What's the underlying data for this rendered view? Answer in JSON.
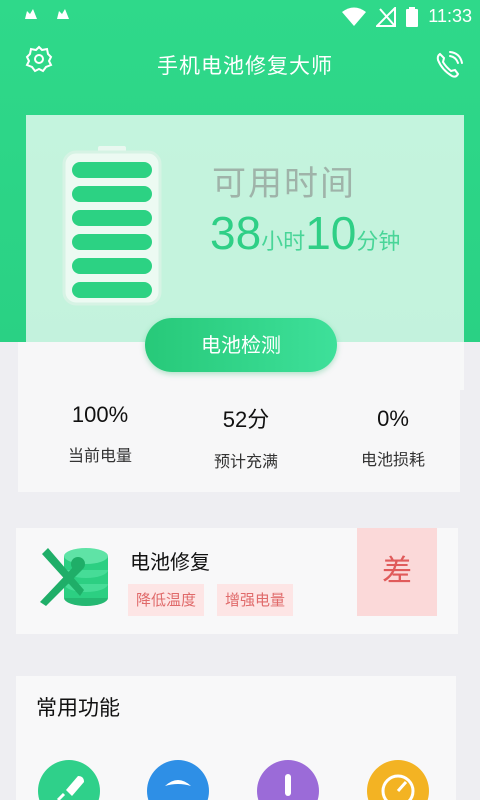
{
  "status_bar": {
    "time": "11:33"
  },
  "app_bar": {
    "title": "手机电池修复大师"
  },
  "battery": {
    "available_label": "可用时间",
    "hours": "38",
    "hours_unit": "小时",
    "minutes": "10",
    "minutes_unit": "分钟",
    "detect_button": "电池检测"
  },
  "stats": [
    {
      "value": "100%",
      "label": "当前电量"
    },
    {
      "value": "52分",
      "label": "预计充满"
    },
    {
      "value": "0%",
      "label": "电池损耗"
    }
  ],
  "repair": {
    "title": "电池修复",
    "tags": [
      "降低温度",
      "增强电量"
    ],
    "grade": "差"
  },
  "functions": {
    "title": "常用功能",
    "icons": [
      {
        "icon": "rocket-icon",
        "color": "#2fd08a"
      },
      {
        "icon": "cleaner-icon",
        "color": "#2e8fe6"
      },
      {
        "icon": "thermometer-icon",
        "color": "#9b6bd8"
      },
      {
        "icon": "speed-icon",
        "color": "#f3b323"
      }
    ]
  },
  "colors": {
    "primary": "#2fd98a",
    "grade_red": "#e05b5b"
  }
}
